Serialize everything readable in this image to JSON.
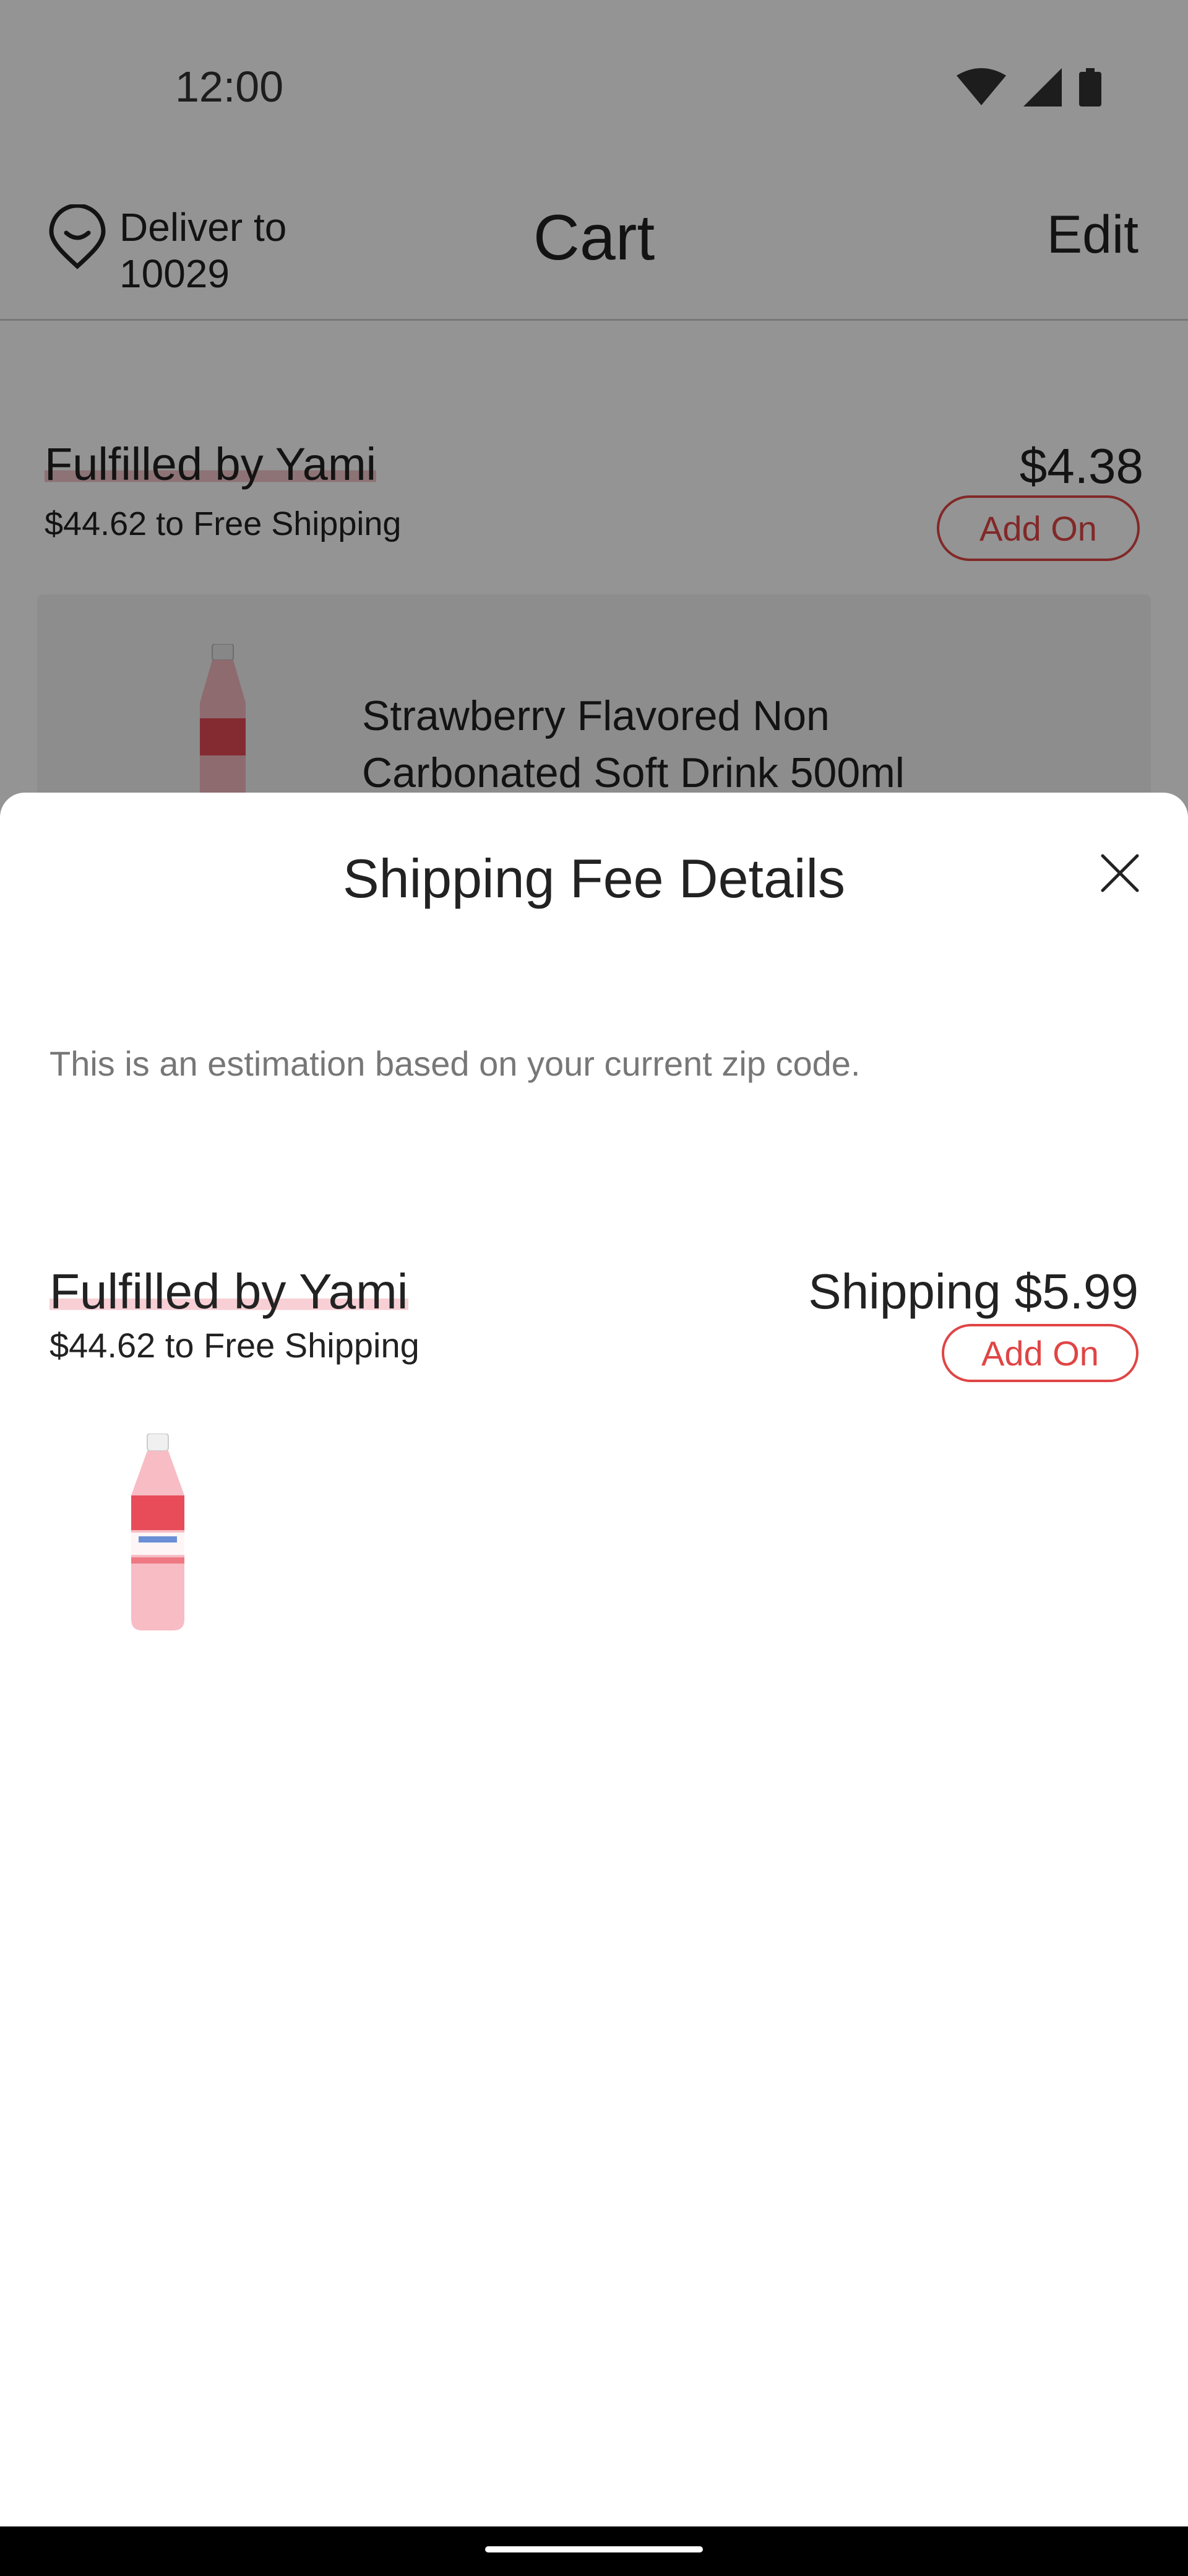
{
  "status_bar": {
    "time": "12:00"
  },
  "header": {
    "deliver_to": "Deliver to 10029",
    "title": "Cart",
    "edit": "Edit"
  },
  "cart_section": {
    "title": "Fulfilled by Yami",
    "free_shipping_note": "$44.62 to Free Shipping",
    "price": "$4.38",
    "add_on": "Add On",
    "item_name": "Strawberry Flavored Non Carbonated Soft Drink 500ml"
  },
  "sheet": {
    "title": "Shipping Fee Details",
    "note": "This is an estimation based on your current zip code.",
    "group": {
      "title": "Fulfilled by Yami",
      "free_shipping_note": "$44.62 to Free Shipping",
      "shipping": "Shipping $5.99",
      "add_on": "Add On"
    }
  },
  "colors": {
    "accent": "#e04545",
    "highlight": "#f7cfd4",
    "scrim": "rgba(0,0,0,0.42)"
  }
}
